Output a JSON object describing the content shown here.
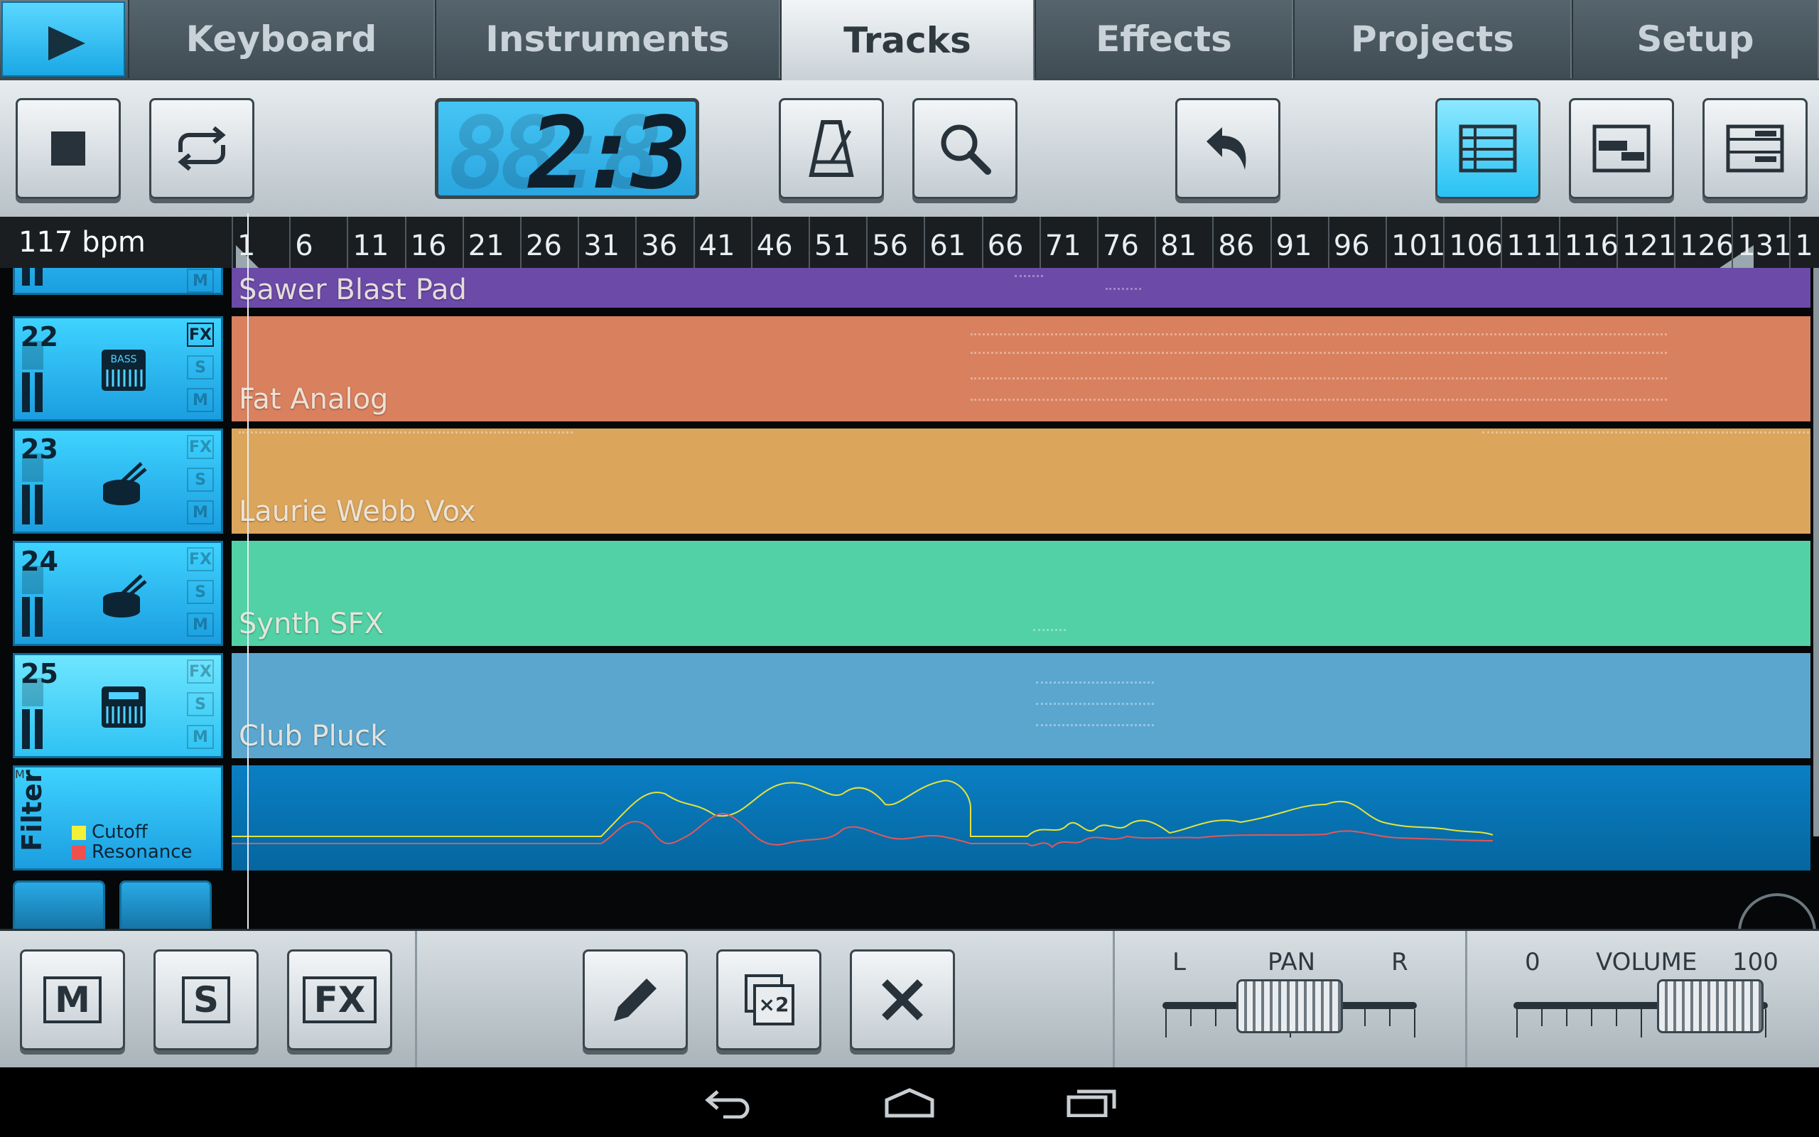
{
  "tabs": [
    {
      "label": "Keyboard"
    },
    {
      "label": "Instruments"
    },
    {
      "label": "Tracks"
    },
    {
      "label": "Effects"
    },
    {
      "label": "Projects"
    },
    {
      "label": "Setup"
    }
  ],
  "position_display": "2:3",
  "tempo": "117 bpm",
  "ruler_bars": [
    "1",
    "6",
    "11",
    "16",
    "21",
    "26",
    "31",
    "36",
    "41",
    "46",
    "51",
    "56",
    "61",
    "66",
    "71",
    "76",
    "81",
    "86",
    "91",
    "96",
    "101",
    "106",
    "111",
    "116",
    "121",
    "126",
    "131",
    "1"
  ],
  "tracks": [
    {
      "number": "",
      "name": "Sawer Blast Pad",
      "icon": "keyboard-icon",
      "color": "#6b4aa8",
      "fx": false
    },
    {
      "number": "22",
      "name": "Fat Analog",
      "icon": "bass-keyboard-icon",
      "color": "#d9805f",
      "fx": true
    },
    {
      "number": "23",
      "name": "Laurie Webb Vox",
      "icon": "drum-icon",
      "color": "#dca55c",
      "fx": false
    },
    {
      "number": "24",
      "name": "Synth SFX",
      "icon": "drum-icon",
      "color": "#52d1a6",
      "fx": false
    },
    {
      "number": "25",
      "name": "Club Pluck",
      "icon": "synth-icon",
      "color": "#5ba6cf",
      "fx": false
    }
  ],
  "badges": {
    "fx": "FX",
    "solo": "S",
    "mute": "M"
  },
  "bass_label": "BASS",
  "automation": {
    "title": "Filter",
    "params": [
      {
        "label": "Cutoff",
        "color": "#f3f03a"
      },
      {
        "label": "Resonance",
        "color": "#ee5050"
      }
    ]
  },
  "bottom": {
    "mute_label": "M",
    "solo_label": "S",
    "fx_label": "FX",
    "duplicate_label": "×2",
    "pan": {
      "title": "PAN",
      "left": "L",
      "right": "R",
      "value": 0.5
    },
    "volume": {
      "title": "VOLUME",
      "min": "0",
      "max": "100",
      "value": 0.78
    }
  }
}
